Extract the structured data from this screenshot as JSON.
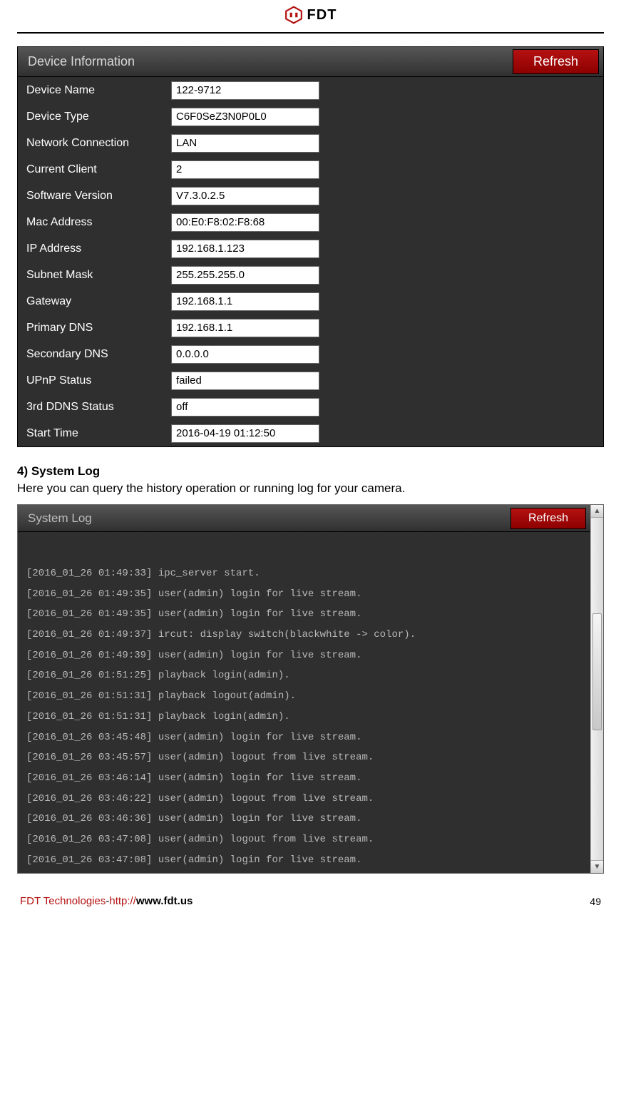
{
  "header": {
    "brand": "FDT"
  },
  "device_info_panel": {
    "title": "Device Information",
    "refresh_label": "Refresh",
    "rows": [
      {
        "label": "Device Name",
        "value": "122-9712"
      },
      {
        "label": "Device Type",
        "value": "C6F0SeZ3N0P0L0"
      },
      {
        "label": "Network Connection",
        "value": "LAN"
      },
      {
        "label": "Current Client",
        "value": "2"
      },
      {
        "label": "Software Version",
        "value": "V7.3.0.2.5"
      },
      {
        "label": "Mac Address",
        "value": "00:E0:F8:02:F8:68"
      },
      {
        "label": "IP Address",
        "value": "192.168.1.123"
      },
      {
        "label": "Subnet Mask",
        "value": "255.255.255.0"
      },
      {
        "label": "Gateway",
        "value": "192.168.1.1"
      },
      {
        "label": "Primary DNS",
        "value": "192.168.1.1"
      },
      {
        "label": "Secondary DNS",
        "value": "0.0.0.0"
      },
      {
        "label": "UPnP Status",
        "value": "failed"
      },
      {
        "label": "3rd DDNS Status",
        "value": "off"
      },
      {
        "label": "Start Time",
        "value": "2016-04-19 01:12:50"
      }
    ]
  },
  "section": {
    "heading": "4) System Log",
    "description": "Here you can query the history operation or running log for your camera."
  },
  "log_panel": {
    "title": "System Log",
    "refresh_label": "Refresh",
    "lines": [
      "[2016_01_26 01:49:33]  ipc_server start.",
      "[2016_01_26 01:49:35]  user(admin) login  for  live stream.",
      "[2016_01_26 01:49:35]  user(admin) login  for  live stream.",
      "[2016_01_26 01:49:37]  ircut: display switch(blackwhite -> color).",
      "[2016_01_26 01:49:39]  user(admin) login  for  live stream.",
      "[2016_01_26 01:51:25]  playback login(admin).",
      "[2016_01_26 01:51:31]  playback logout(admin).",
      "[2016_01_26 01:51:31]  playback login(admin).",
      "[2016_01_26 03:45:48]  user(admin) login  for  live stream.",
      "[2016_01_26 03:45:57]  user(admin) logout from live stream.",
      "[2016_01_26 03:46:14]  user(admin) login  for  live stream.",
      "[2016_01_26 03:46:22]  user(admin) logout from live stream.",
      "[2016_01_26 03:46:36]  user(admin) login  for  live stream.",
      "[2016_01_26 03:47:08]  user(admin) logout from live stream.",
      "[2016_01_26 03:47:08]  user(admin) login  for  live stream."
    ]
  },
  "footer": {
    "company": "FDT Technologies",
    "separator": "-",
    "url_proto": "http://",
    "url_rest": "www.fdt.us",
    "page_number": "49"
  }
}
